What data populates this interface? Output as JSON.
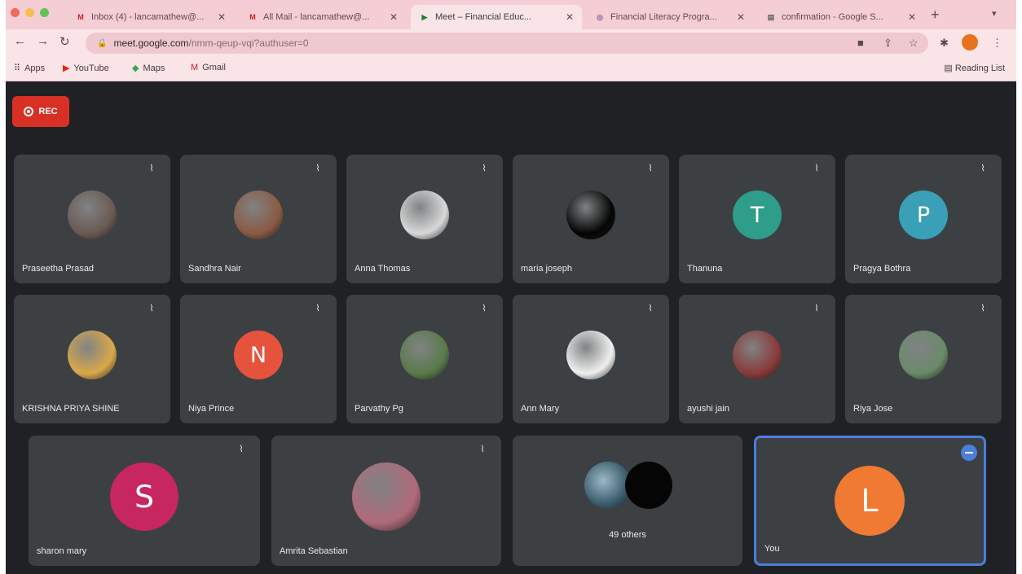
{
  "browser": {
    "tabs": [
      {
        "label": "Inbox (4) - lancamathew@...",
        "favicon": "M",
        "fav_color": "#c5221f",
        "active": false
      },
      {
        "label": "All Mail - lancamathew@...",
        "favicon": "M",
        "fav_color": "#c5221f",
        "active": false
      },
      {
        "label": "Meet – Financial Educ...",
        "favicon": "▶",
        "fav_color": "#188038",
        "active": true
      },
      {
        "label": "Financial Literacy Progra...",
        "favicon": "◎",
        "fav_color": "#7b5ea7",
        "active": false
      },
      {
        "label": "confirmation - Google S...",
        "favicon": "▤",
        "fav_color": "#5f6368",
        "active": false
      }
    ],
    "url_host": "meet.google.com",
    "url_path": "/nmm-qeup-vqi?authuser=0",
    "bookmarks": [
      {
        "label": "Apps",
        "icon": "apps-grid-icon"
      },
      {
        "label": "YouTube",
        "icon": "youtube-icon"
      },
      {
        "label": "Maps",
        "icon": "maps-icon"
      },
      {
        "label": "Gmail",
        "icon": "gmail-icon"
      }
    ],
    "reading_list": "Reading List"
  },
  "meet": {
    "rec_label": "REC",
    "participants": [
      {
        "name": "Praseetha Prasad",
        "type": "photo",
        "color": "#6a5a52"
      },
      {
        "name": "Sandhra Nair",
        "type": "photo",
        "color": "#8a5a44"
      },
      {
        "name": "Anna Thomas",
        "type": "photo",
        "color": "#d8d8d8"
      },
      {
        "name": "maria joseph",
        "type": "photo",
        "color": "#050505"
      },
      {
        "name": "Thanuna",
        "type": "initial",
        "initial": "T",
        "color": "#2e9d8a"
      },
      {
        "name": "Pragya Bothra",
        "type": "initial",
        "initial": "P",
        "color": "#3aa0b8"
      },
      {
        "name": "KRISHNA PRIYA SHINE",
        "type": "photo",
        "color": "#d9a84a"
      },
      {
        "name": "Niya Prince",
        "type": "initial",
        "initial": "N",
        "color": "#e5533d"
      },
      {
        "name": "Parvathy Pg",
        "type": "photo",
        "color": "#5a7a4a"
      },
      {
        "name": "Ann Mary",
        "type": "photo",
        "color": "#efefef"
      },
      {
        "name": "ayushi jain",
        "type": "photo",
        "color": "#8a3a3a"
      },
      {
        "name": "Riya Jose",
        "type": "photo",
        "color": "#6a8a6a"
      },
      {
        "name": "sharon mary",
        "type": "initial",
        "initial": "S",
        "color": "#c8265e"
      },
      {
        "name": "Amrita Sebastian",
        "type": "photo",
        "color": "#b06a7a"
      }
    ],
    "others_label": "49 others",
    "self": {
      "name": "You",
      "initial": "L",
      "color": "#f07a32"
    }
  }
}
